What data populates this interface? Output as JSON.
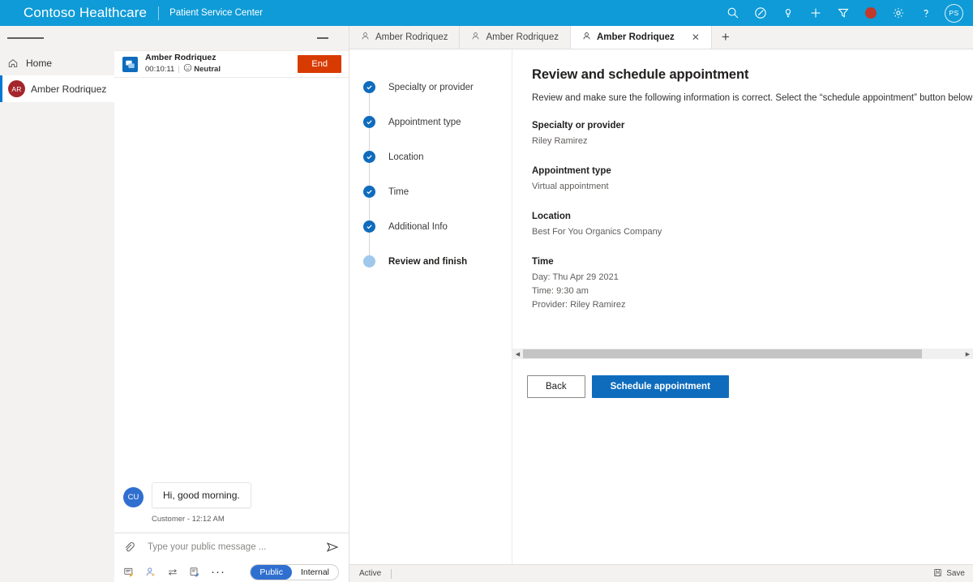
{
  "topbar": {
    "brand": "Contoso Healthcare",
    "subbrand": "Patient Service Center",
    "icons": [
      {
        "name": "search-icon"
      },
      {
        "name": "assistant-icon"
      },
      {
        "name": "lightbulb-icon"
      },
      {
        "name": "add-icon"
      },
      {
        "name": "filter-icon"
      },
      {
        "name": "recording-indicator-icon"
      },
      {
        "name": "gear-icon"
      },
      {
        "name": "help-icon"
      }
    ],
    "avatar_initials": "PS"
  },
  "sidebar": {
    "items": [
      {
        "label": "Home",
        "icon": "home-icon",
        "active": false
      },
      {
        "label": "Amber Rodriquez",
        "initials": "AR",
        "active": true
      }
    ]
  },
  "chat": {
    "customer_name": "Amber Rodriquez",
    "timer": "00:10:11",
    "separator": "|",
    "sentiment": "Neutral",
    "end_label": "End",
    "messages": [
      {
        "initials": "CU",
        "text": "Hi, good morning.",
        "meta": "Customer - 12:12 AM"
      }
    ],
    "composer": {
      "placeholder": "Type your public message ...",
      "value": "",
      "more_label": "···",
      "toggle": {
        "public": "Public",
        "internal": "Internal",
        "selected": "Public"
      }
    }
  },
  "tabs": [
    {
      "label": "Amber Rodriquez",
      "active": false
    },
    {
      "label": "Amber Rodriquez",
      "active": false
    },
    {
      "label": "Amber Rodriquez",
      "active": true
    }
  ],
  "tab_add_label": "+",
  "stepper": {
    "steps": [
      {
        "label": "Specialty or provider",
        "state": "complete"
      },
      {
        "label": "Appointment type",
        "state": "complete"
      },
      {
        "label": "Location",
        "state": "complete"
      },
      {
        "label": "Time",
        "state": "complete"
      },
      {
        "label": "Additional Info",
        "state": "complete"
      },
      {
        "label": "Review and finish",
        "state": "current"
      }
    ]
  },
  "pane": {
    "title": "Review and schedule appointment",
    "description": "Review and make sure the following information is correct. Select the “schedule appointment” button below to book the appointment.",
    "fields": [
      {
        "label": "Specialty or provider",
        "value": "Riley Ramirez"
      },
      {
        "label": "Appointment type",
        "value": "Virtual appointment"
      },
      {
        "label": "Location",
        "value": "Best For You Organics Company"
      },
      {
        "label": "Time",
        "value": "Day: Thu Apr 29 2021\nTime: 9:30 am\nProvider: Riley Ramirez"
      }
    ],
    "buttons": {
      "back": "Back",
      "submit": "Schedule appointment"
    }
  },
  "statusbar": {
    "status": "Active",
    "save_label": "Save"
  },
  "colors": {
    "brand_blue": "#0f9bd7",
    "accent_blue": "#0f6cbd",
    "end_orange": "#d83b01",
    "avatar_red": "#a4262c",
    "record_red": "#c0392b"
  }
}
